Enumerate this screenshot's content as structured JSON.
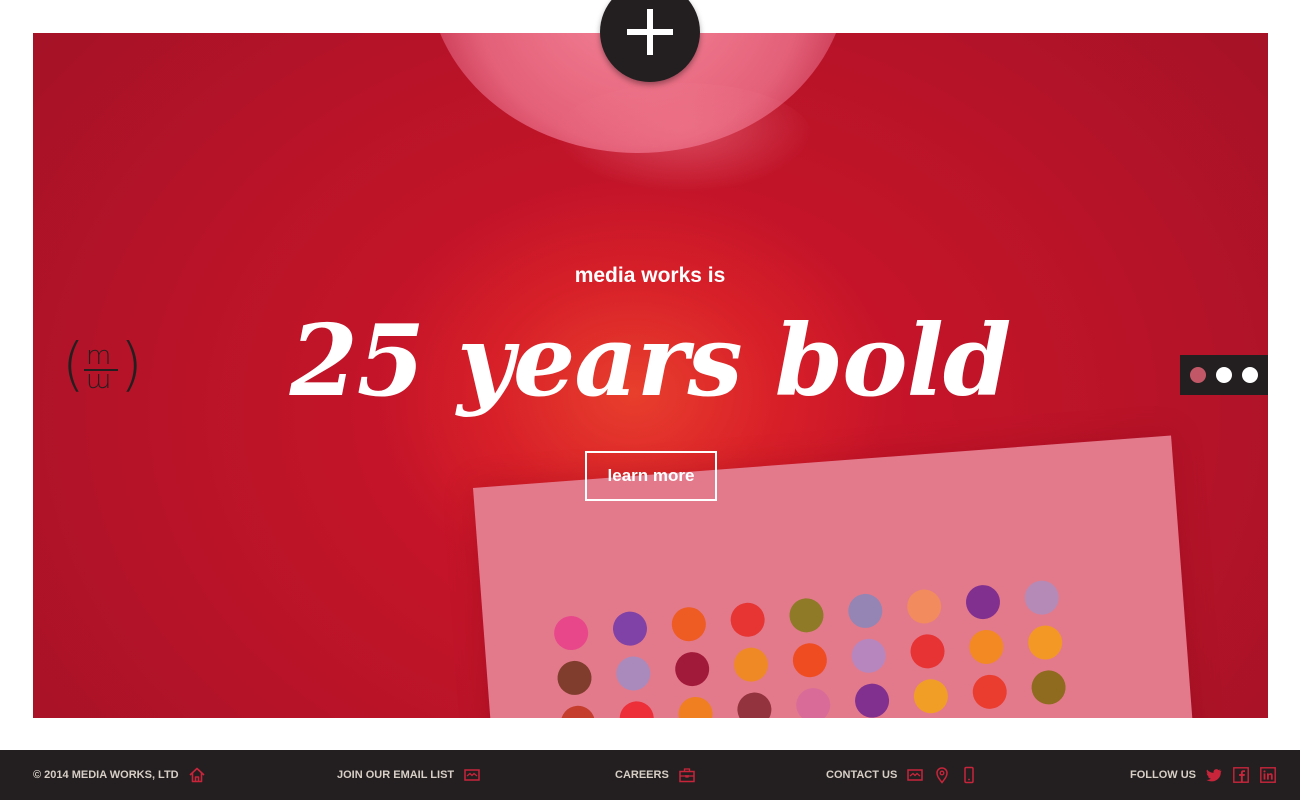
{
  "hero": {
    "tagline": "media works is",
    "headline": "25 years bold",
    "cta_label": "learn more",
    "slide_count": 3,
    "active_slide": 1
  },
  "logo": {
    "top_letter": "m",
    "bottom_letter": "m"
  },
  "footer": {
    "copyright": "© 2014 MEDIA WORKS, LTD",
    "email_list": "JOIN OUR EMAIL LIST",
    "careers": "CAREERS",
    "contact": "CONTACT US",
    "follow": "FOLLOW US"
  },
  "colors": {
    "hero_red": "#c8102e",
    "dark": "#231f20",
    "footer_text": "#d7cfc6",
    "icon_accent": "#c8253b",
    "active_dot": "#c25867"
  },
  "icons": [
    "plus-icon",
    "home-icon",
    "mail-icon",
    "briefcase-icon",
    "map-pin-icon",
    "mobile-phone-icon",
    "twitter-icon",
    "facebook-icon",
    "linkedin-icon"
  ]
}
